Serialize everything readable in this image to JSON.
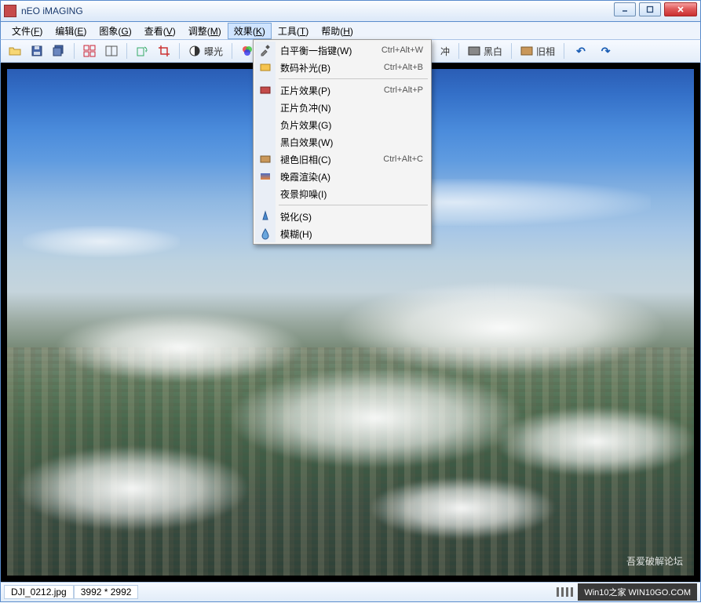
{
  "window": {
    "title": "nEO iMAGING"
  },
  "menubar": {
    "items": [
      {
        "label": "文件",
        "key": "F"
      },
      {
        "label": "编辑",
        "key": "E"
      },
      {
        "label": "图象",
        "key": "G"
      },
      {
        "label": "查看",
        "key": "V"
      },
      {
        "label": "调整",
        "key": "M"
      },
      {
        "label": "效果",
        "key": "K"
      },
      {
        "label": "工具",
        "key": "T"
      },
      {
        "label": "帮助",
        "key": "H"
      }
    ],
    "active_index": 5
  },
  "toolbar": {
    "exposure_label": "曝光",
    "buffer_label": "冲",
    "bw_label": "黑白",
    "old_label": "旧相"
  },
  "dropdown": {
    "groups": [
      [
        {
          "icon": "wb",
          "label": "白平衡一指键(W)",
          "shortcut": "Ctrl+Alt+W"
        },
        {
          "icon": "fill",
          "label": "数码补光(B)",
          "shortcut": "Ctrl+Alt+B"
        }
      ],
      [
        {
          "icon": "film",
          "label": "正片效果(P)",
          "shortcut": "Ctrl+Alt+P"
        },
        {
          "icon": "",
          "label": "正片负冲(N)",
          "shortcut": ""
        },
        {
          "icon": "",
          "label": "负片效果(G)",
          "shortcut": ""
        },
        {
          "icon": "",
          "label": "黑白效果(W)",
          "shortcut": ""
        },
        {
          "icon": "sepia",
          "label": "褪色旧相(C)",
          "shortcut": "Ctrl+Alt+C"
        },
        {
          "icon": "sunset",
          "label": "晚霞渲染(A)",
          "shortcut": ""
        },
        {
          "icon": "",
          "label": "夜景抑噪(I)",
          "shortcut": ""
        }
      ],
      [
        {
          "icon": "sharpen",
          "label": "锐化(S)",
          "shortcut": ""
        },
        {
          "icon": "blur",
          "label": "模糊(H)",
          "shortcut": ""
        }
      ]
    ]
  },
  "status": {
    "filename": "DJI_0212.jpg",
    "dimensions": "3992 * 2992",
    "tray_text": "Win10之家 WIN10GO.COM"
  },
  "watermark": {
    "text": "吾爱破解论坛"
  }
}
